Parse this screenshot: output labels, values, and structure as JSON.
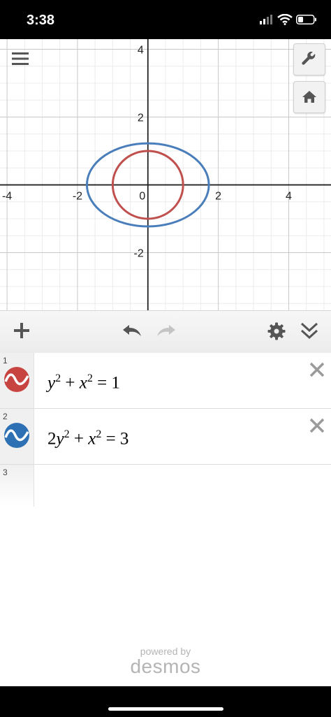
{
  "status_bar": {
    "time": "3:38"
  },
  "graph": {
    "axis_range": {
      "x": [
        -4.2,
        5.2
      ],
      "y": [
        -3.7,
        4.3
      ]
    },
    "x_ticks": [
      "-4",
      "-2",
      "0",
      "2",
      "4"
    ],
    "y_ticks": [
      "4",
      "2",
      "-2"
    ],
    "curves": [
      {
        "name": "",
        "rx": 1,
        "ry": 1,
        "color": "#c0504d"
      },
      {
        "name": "",
        "rx": 1.732,
        "ry": 1.225,
        "color": "#4a7ebb"
      }
    ]
  },
  "expressions": [
    {
      "index": "1",
      "color": "#c74440",
      "latex": "y²+x²=1"
    },
    {
      "index": "2",
      "color": "#2d70b3",
      "latex": "2y²+x²=3"
    },
    {
      "index": "3"
    }
  ],
  "footer": {
    "powered_by": "powered by",
    "brand": "desmos"
  },
  "icons": {
    "menu": "hamburger-menu-icon",
    "settings": "wrench-icon",
    "home": "home-icon",
    "add": "plus-icon",
    "undo": "undo-icon",
    "redo": "redo-icon",
    "gear": "gear-icon",
    "collapse": "double-chevron-down-icon",
    "delete": "close-icon"
  }
}
